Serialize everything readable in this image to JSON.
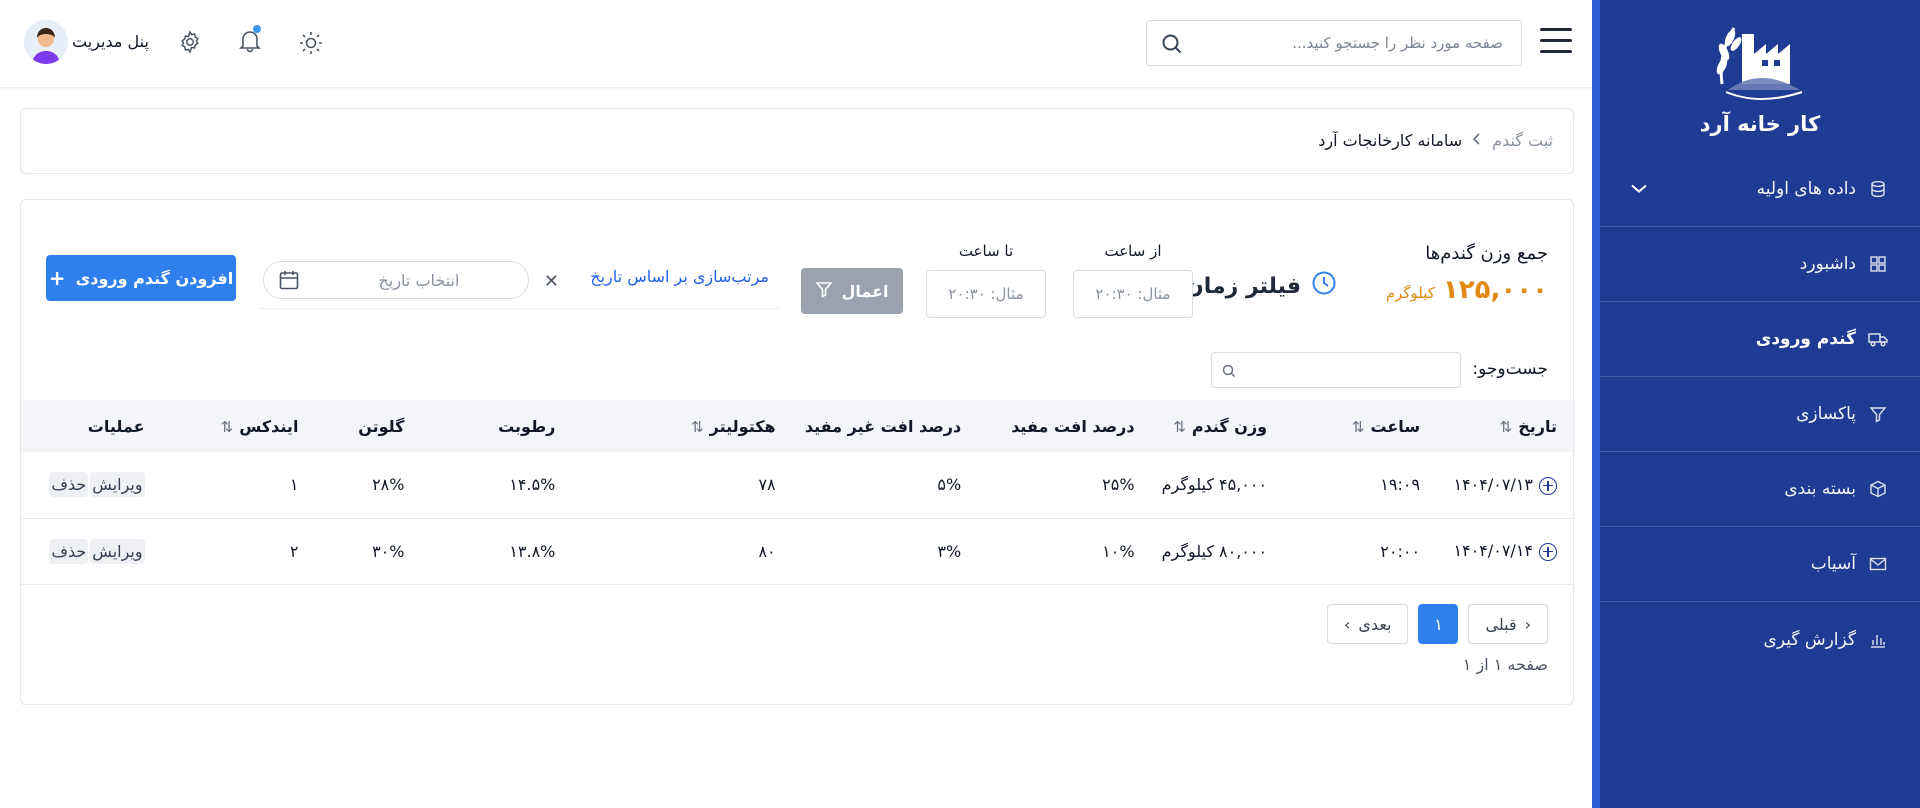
{
  "brand": {
    "name": "کار خانه آرد"
  },
  "sidebar": {
    "items": [
      {
        "label": "داده های اولیه",
        "icon": "database-icon",
        "has_chevron": true
      },
      {
        "label": "داشبورد",
        "icon": "dashboard-grid-icon"
      },
      {
        "label": "گندم ورودی",
        "icon": "truck-icon",
        "active": true
      },
      {
        "label": "پاکسازی",
        "icon": "filter-icon"
      },
      {
        "label": "بسته بندی",
        "icon": "package-icon"
      },
      {
        "label": "آسیاب",
        "icon": "mail-icon"
      },
      {
        "label": "گزارش گیری",
        "icon": "bar-chart-icon"
      }
    ]
  },
  "header": {
    "search_placeholder": "صفحه مورد نظر را جستجو کنید...",
    "admin_label": "پنل مدیریت"
  },
  "breadcrumb": {
    "items": [
      "ثبت گندم",
      "سامانه کارخانجات آرد"
    ]
  },
  "summary": {
    "title": "جمع وزن گندم‌ها",
    "value": "۱۲۵,۰۰۰",
    "unit": "کیلوگرم"
  },
  "filter": {
    "title": "فیلتر زمان",
    "from_label": "از ساعت",
    "to_label": "تا ساعت",
    "from_placeholder": "مثال: ۲۰:۳۰",
    "to_placeholder": "مثال: ۲۰:۳۰",
    "apply_label": "اعمال",
    "sort_label": "مرتب‌سازی بر اساس تاریخ",
    "date_placeholder": "انتخاب تاریخ",
    "add_label": "افزودن گندم ورودی"
  },
  "table_search": {
    "label": "جست‌وجو:"
  },
  "table": {
    "headers": [
      "تاریخ",
      "ساعت",
      "وزن گندم",
      "درصد افت مفید",
      "درصد افت غیر مفید",
      "هکتولیتر",
      "رطوبت",
      "گلوتن",
      "ایندکس",
      "عملیات"
    ],
    "rows": [
      {
        "date": "۱۴۰۴/۰۷/۱۳",
        "time": "۱۹:۰۹",
        "weight": "۴۵,۰۰۰ کیلوگرم",
        "useful": "۲۵%",
        "nonuseful": "۵%",
        "hecto": "۷۸",
        "moisture": "۱۴.۵%",
        "gluten": "۲۸%",
        "index": "۱",
        "edit": "ویرایش",
        "delete": "حذف"
      },
      {
        "date": "۱۴۰۴/۰۷/۱۴",
        "time": "۲۰:۰۰",
        "weight": "۸۰,۰۰۰ کیلوگرم",
        "useful": "۱۰%",
        "nonuseful": "۳%",
        "hecto": "۸۰",
        "moisture": "۱۳.۸%",
        "gluten": "۳۰%",
        "index": "۲",
        "edit": "ویرایش",
        "delete": "حذف"
      }
    ]
  },
  "pagination": {
    "prev": "قبلی",
    "current": "۱",
    "next": "بعدی",
    "info": "صفحه ۱ از ۱"
  },
  "colors": {
    "sidebar": "#1f3b93",
    "accent": "#2f80ed",
    "summary": "#e08a14"
  }
}
